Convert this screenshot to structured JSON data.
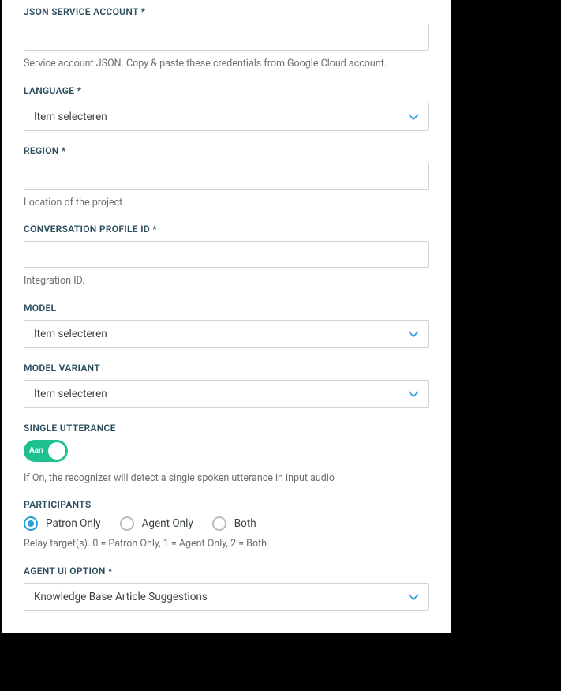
{
  "fields": {
    "json_service_account": {
      "label": "JSON SERVICE ACCOUNT *",
      "help": "Service account JSON. Copy & paste these credentials from Google Cloud account.",
      "value": ""
    },
    "language": {
      "label": "LANGUAGE *",
      "selected": "Item selecteren"
    },
    "region": {
      "label": "REGION *",
      "help": "Location of the project.",
      "value": ""
    },
    "conversation_profile_id": {
      "label": "CONVERSATION PROFILE ID *",
      "help": "Integration ID.",
      "value": ""
    },
    "model": {
      "label": "MODEL",
      "selected": "Item selecteren"
    },
    "model_variant": {
      "label": "MODEL VARIANT",
      "selected": "Item selecteren"
    },
    "single_utterance": {
      "label": "SINGLE UTTERANCE",
      "toggle_text": "Aan",
      "help": "If On, the recognizer will detect a single spoken utterance in input audio"
    },
    "participants": {
      "label": "PARTICIPANTS",
      "options": [
        "Patron Only",
        "Agent Only",
        "Both"
      ],
      "selected_index": 0,
      "help": "Relay target(s). 0 = Patron Only, 1 = Agent Only, 2 = Both"
    },
    "agent_ui_option": {
      "label": "AGENT UI OPTION *",
      "selected": "Knowledge Base Article Suggestions"
    }
  }
}
